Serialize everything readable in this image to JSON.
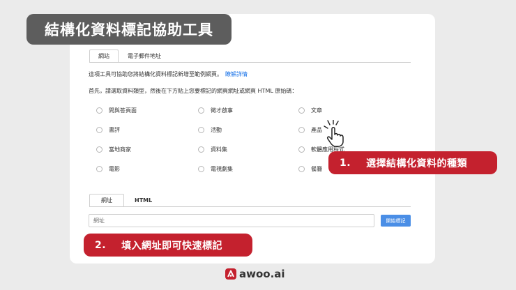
{
  "banner": {
    "title": "結構化資料標記協助工具"
  },
  "top_tabs": [
    {
      "label": "網站"
    },
    {
      "label": "電子郵件地址"
    }
  ],
  "intro": {
    "text": "這項工具可協助您將結構化資料標記新增至範例網頁。",
    "link": "瞭解詳情"
  },
  "prompt": "首先，請選取資料類型，然後在下方貼上您要標記的網頁網址或網頁 HTML 原始碼：",
  "data_types": [
    {
      "label": "問與答頁面"
    },
    {
      "label": "徵才啟事"
    },
    {
      "label": "文章"
    },
    {
      "label": "書評"
    },
    {
      "label": "活動"
    },
    {
      "label": "產品"
    },
    {
      "label": "當地商家"
    },
    {
      "label": "資料集"
    },
    {
      "label": "軟體應用程式"
    },
    {
      "label": "電影"
    },
    {
      "label": "電視劇集"
    },
    {
      "label": "餐廳"
    }
  ],
  "input_tabs": [
    {
      "label": "網址"
    },
    {
      "label": "HTML"
    }
  ],
  "url_input": {
    "placeholder": "網址",
    "value": ""
  },
  "start_button": {
    "label": "開始標記"
  },
  "callouts": {
    "one": {
      "num": "1.",
      "text": "選擇結構化資料的種類"
    },
    "two": {
      "num": "2.",
      "text": "填入網址即可快速標記"
    }
  },
  "logo": {
    "text": "awoo.ai"
  },
  "colors": {
    "accent_red": "#c4212e",
    "banner_gray": "#5d5d5d",
    "link_blue": "#1a73e8",
    "button_blue": "#4a8ee6"
  }
}
